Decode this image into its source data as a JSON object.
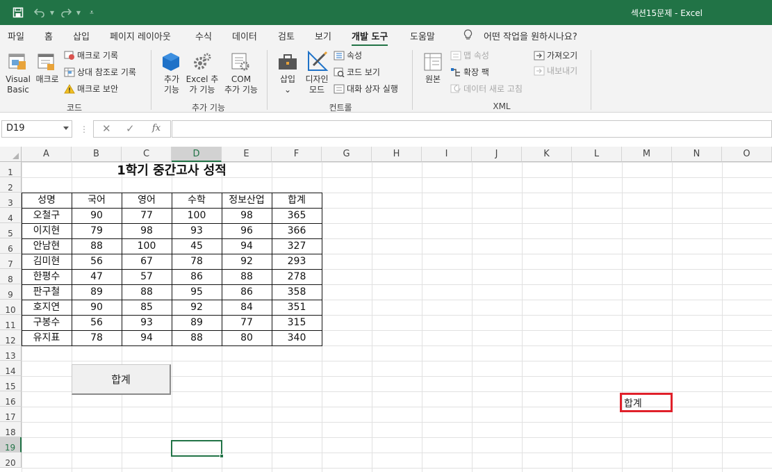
{
  "window": {
    "title": "섹션15문제 - Excel"
  },
  "ribbon_tabs": [
    "파일",
    "홈",
    "삽입",
    "페이지 레이아웃",
    "수식",
    "데이터",
    "검토",
    "보기",
    "개발 도구",
    "도움말"
  ],
  "tell_me": "어떤 작업을 원하시나요?",
  "ribbon": {
    "code": {
      "label": "코드",
      "visual_basic": [
        "Visual",
        "Basic"
      ],
      "macros": "매크로",
      "record_macro": "매크로 기록",
      "relative_ref": "상대 참조로 기록",
      "macro_security": "매크로 보안"
    },
    "addins": {
      "label": "추가 기능",
      "addins_btn": [
        "추가",
        "기능"
      ],
      "excel_addins": [
        "Excel 추",
        "가 기능"
      ],
      "com_addins": [
        "COM",
        "추가 기능"
      ]
    },
    "controls": {
      "label": "컨트롤",
      "insert": [
        "삽입",
        "⌄"
      ],
      "design_mode": [
        "디자인",
        "모드"
      ],
      "properties": "속성",
      "view_code": "코드 보기",
      "run_dialog": "대화 상자 실행"
    },
    "xml": {
      "label": "XML",
      "source": "원본",
      "map_props": "맵 속성",
      "expansion_packs": "확장 팩",
      "refresh_data": "데이터 새로 고침",
      "import": "가져오기",
      "export": "내보내기"
    }
  },
  "formula_bar": {
    "name_box": "D19",
    "cancel": "✕",
    "enter": "✓",
    "fx": "fx",
    "formula": ""
  },
  "sheet": {
    "columns": [
      "A",
      "B",
      "C",
      "D",
      "E",
      "F",
      "G",
      "H",
      "I",
      "J",
      "K",
      "L",
      "M",
      "N",
      "O"
    ],
    "rows": [
      "1",
      "2",
      "3",
      "4",
      "5",
      "6",
      "7",
      "8",
      "9",
      "10",
      "11",
      "12",
      "13",
      "14",
      "15",
      "16",
      "17",
      "18",
      "19",
      "20"
    ],
    "selected_cell": "D19",
    "title": "1학기 중간고사 성적",
    "table": {
      "headers": [
        "성명",
        "국어",
        "영어",
        "수학",
        "정보산업",
        "합계"
      ],
      "rows": [
        [
          "오철구",
          "90",
          "77",
          "100",
          "98",
          "365"
        ],
        [
          "이지현",
          "79",
          "98",
          "93",
          "96",
          "366"
        ],
        [
          "안남현",
          "88",
          "100",
          "45",
          "94",
          "327"
        ],
        [
          "김미현",
          "56",
          "67",
          "78",
          "92",
          "293"
        ],
        [
          "한평수",
          "47",
          "57",
          "86",
          "88",
          "278"
        ],
        [
          "판구철",
          "89",
          "88",
          "95",
          "86",
          "358"
        ],
        [
          "호지연",
          "90",
          "85",
          "92",
          "84",
          "351"
        ],
        [
          "구봉수",
          "56",
          "93",
          "89",
          "77",
          "315"
        ],
        [
          "유지표",
          "78",
          "94",
          "88",
          "80",
          "340"
        ]
      ]
    },
    "sum_button": "합계",
    "m16_text": "합계"
  },
  "colors": {
    "excel_green": "#217346",
    "highlight_red": "#e0202a"
  }
}
